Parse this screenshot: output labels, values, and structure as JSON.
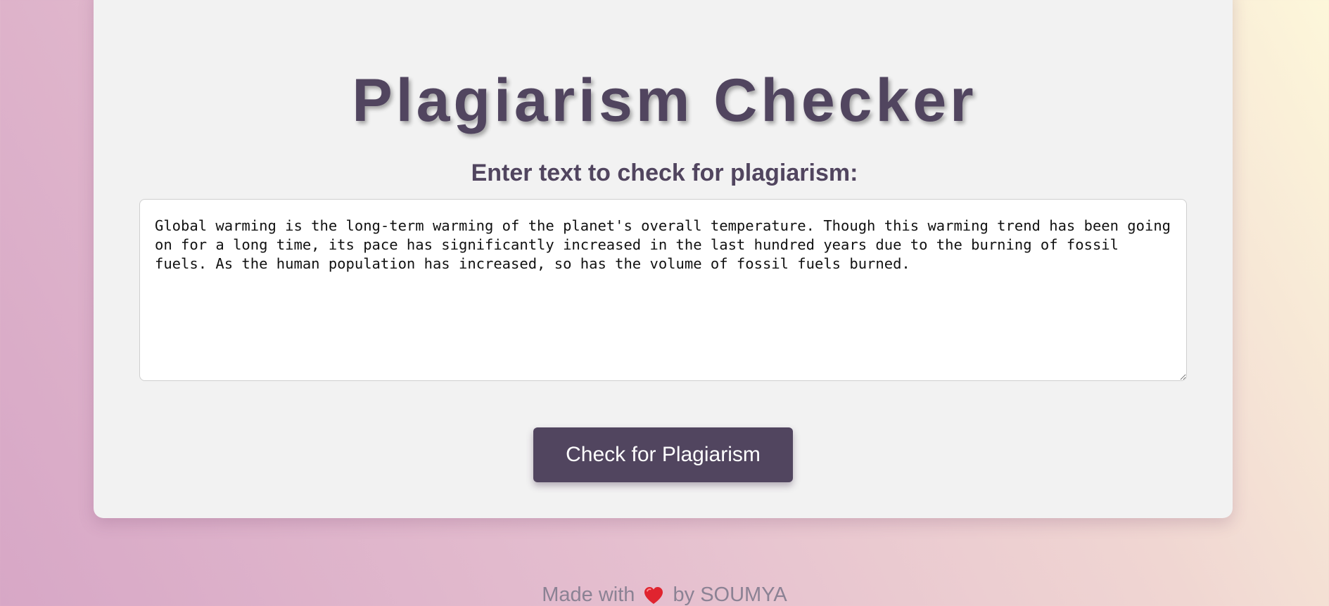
{
  "header": {
    "title": "Plagiarism Checker",
    "subtitle": "Enter text to check for plagiarism:"
  },
  "input": {
    "value": "Global warming is the long-term warming of the planet's overall temperature. Though this warming trend has been going on for a long time, its pace has significantly increased in the last hundred years due to the burning of fossil fuels. As the human population has increased, so has the volume of fossil fuels burned."
  },
  "actions": {
    "check_label": "Check for Plagiarism"
  },
  "footer": {
    "made_with": "Made with",
    "by": "by SOUMYA",
    "icon": "heart-icon"
  },
  "colors": {
    "accent": "#51455f",
    "card": "#f2f2f2",
    "heart": "#e0242f"
  }
}
